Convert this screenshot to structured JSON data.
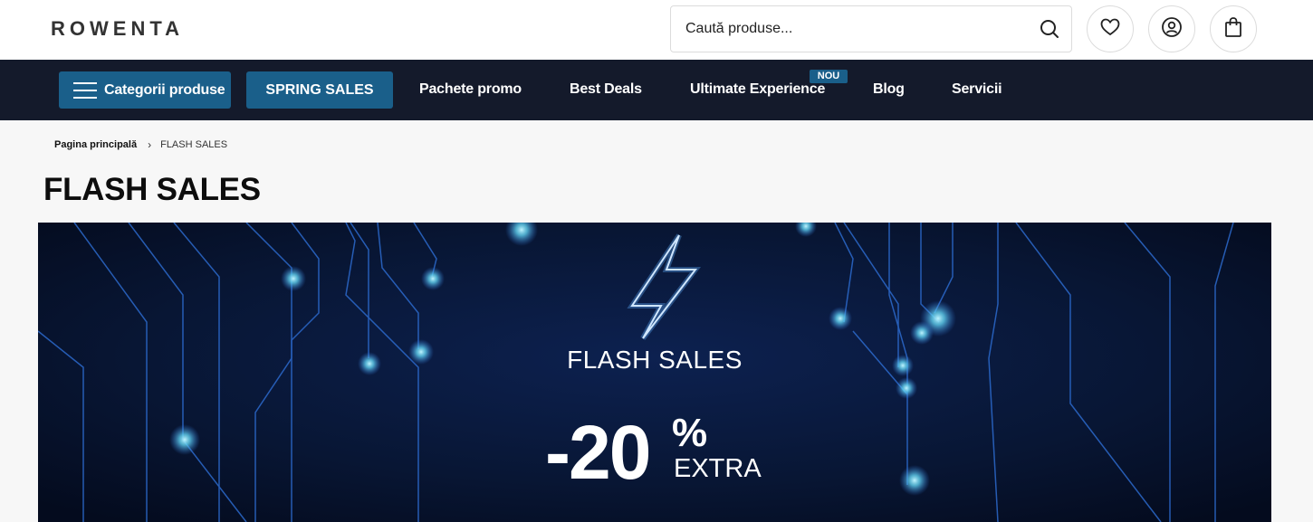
{
  "header": {
    "logo_text": "ROWENTA",
    "search": {
      "placeholder": "Caută produse..."
    },
    "icons": [
      "search-icon",
      "heart-icon",
      "user-icon",
      "bag-icon"
    ]
  },
  "nav": {
    "categories_label": "Categorii produse",
    "spring_sales_label": "SPRING SALES",
    "links": [
      "Pachete promo",
      "Best Deals",
      "Ultimate Experience",
      "Blog",
      "Servicii"
    ],
    "new_badge": "NOU"
  },
  "breadcrumb": {
    "home": "Pagina principală",
    "current": "FLASH SALES"
  },
  "page": {
    "title": "FLASH SALES"
  },
  "banner": {
    "title": "FLASH SALES",
    "discount": "-20",
    "percent": "%",
    "extra": "EXTRA",
    "icon": "lightning-bolt-icon"
  },
  "colors": {
    "nav_bg": "#141a2b",
    "accent": "#1a5f8a",
    "banner_bg": "#07142e",
    "circuit": "#2e6fd6",
    "glow": "#5fd0f0"
  }
}
